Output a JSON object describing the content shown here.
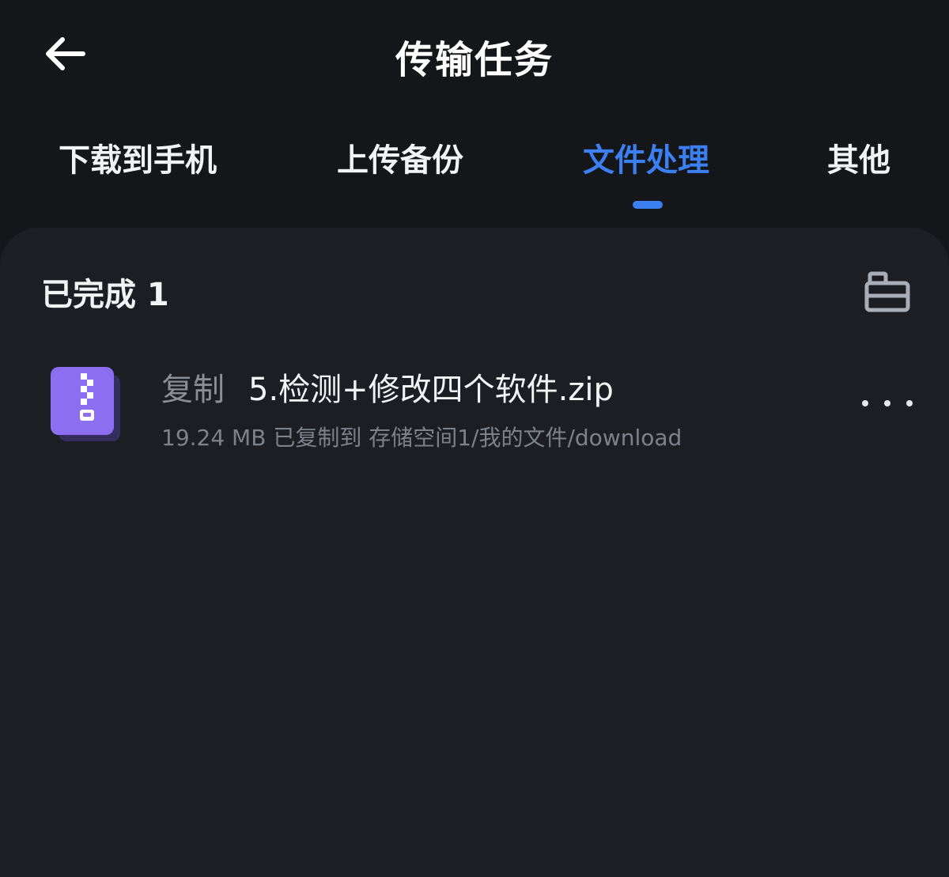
{
  "header": {
    "title": "传输任务",
    "back_icon": "arrow-left-icon"
  },
  "tabs": [
    {
      "label": "下载到手机",
      "active": false
    },
    {
      "label": "上传备份",
      "active": false
    },
    {
      "label": "文件处理",
      "active": true
    },
    {
      "label": "其他",
      "active": false
    }
  ],
  "section": {
    "title": "已完成 1",
    "clear_icon": "toolbox-icon"
  },
  "files": [
    {
      "action": "复制",
      "name": "5.检测+修改四个软件.zip",
      "meta": "19.24 MB 已复制到 存储空间1/我的文件/download",
      "icon": "zip-file-icon",
      "more_icon": "more-dots-icon"
    }
  ],
  "colors": {
    "background": "#14161a",
    "panel": "#1c1e23",
    "accent": "#3b7ff0",
    "zip_icon": "#8b6ff0"
  }
}
